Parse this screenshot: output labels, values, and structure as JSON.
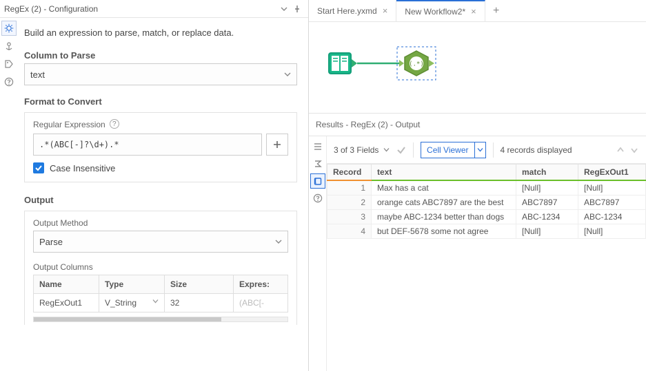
{
  "config": {
    "title": "RegEx (2) - Configuration",
    "intro": "Build an expression to parse, match, or replace data.",
    "column_label": "Column to Parse",
    "column_value": "text",
    "format_label": "Format to Convert",
    "regex_label": "Regular Expression",
    "regex_value": ".*(ABC[-]?\\d+).*",
    "case_insensitive_label": "Case Insensitive",
    "case_insensitive_checked": true,
    "output_label": "Output",
    "output_method_label": "Output Method",
    "output_method_value": "Parse",
    "output_columns_label": "Output Columns",
    "output_columns_headers": [
      "Name",
      "Type",
      "Size",
      "Expres:"
    ],
    "output_columns_row": {
      "name": "RegExOut1",
      "vtype": "V_String",
      "size": "32",
      "expr": "(ABC[-"
    }
  },
  "workflow": {
    "tabs": [
      {
        "label": "Start Here.yxmd",
        "modified": false,
        "active": false
      },
      {
        "label": "New Workflow2",
        "modified": true,
        "active": true
      }
    ]
  },
  "results": {
    "title": "Results - RegEx (2) - Output",
    "fields_summary": "3 of 3 Fields",
    "cell_viewer_label": "Cell Viewer",
    "records_summary": "4 records displayed",
    "columns": [
      "Record",
      "text",
      "match",
      "RegExOut1"
    ],
    "rows": [
      {
        "r": "1",
        "text": "Max has a cat",
        "match": "[Null]",
        "out": "[Null]"
      },
      {
        "r": "2",
        "text": "orange cats ABC7897 are the best",
        "match": "ABC7897",
        "out": "ABC7897"
      },
      {
        "r": "3",
        "text": "maybe ABC-1234 better than dogs",
        "match": "ABC-1234",
        "out": "ABC-1234"
      },
      {
        "r": "4",
        "text": "but DEF-5678 some not agree",
        "match": "[Null]",
        "out": "[Null]"
      }
    ]
  }
}
